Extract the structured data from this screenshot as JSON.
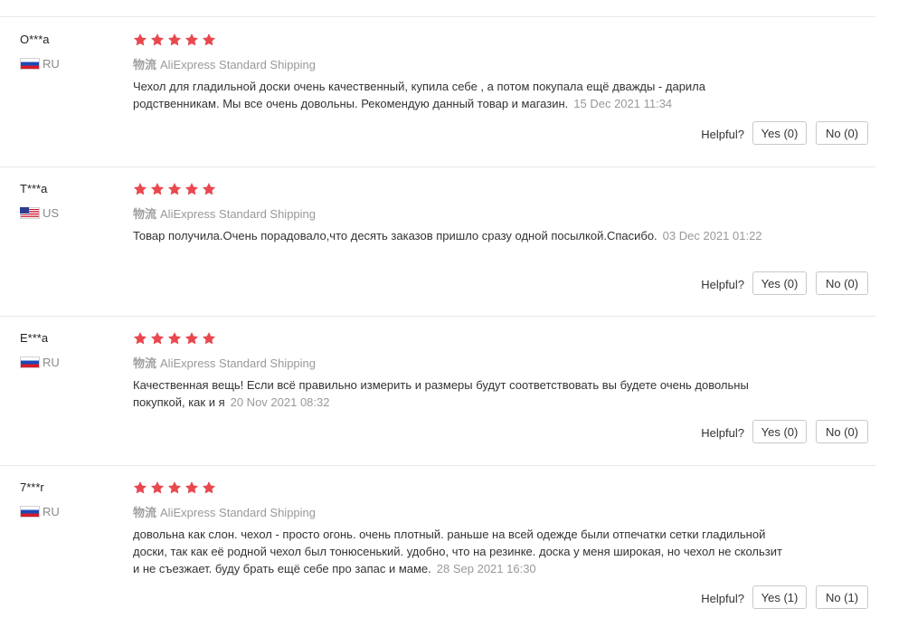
{
  "reviews": [
    {
      "user": "O***a",
      "country": "RU",
      "logistics_label": "物流",
      "shipping": "AliExpress Standard Shipping",
      "text": "Чехол для гладильной доски очень качественный, купила себе , а потом покупала ещё дважды - дарила родственникам. Мы все очень довольны. Рекомендую данный товар и магазин.",
      "date": "15 Dec 2021 11:34",
      "helpful_label": "Helpful?",
      "yes_label": "Yes (0)",
      "no_label": "No (0)"
    },
    {
      "user": "T***a",
      "country": "US",
      "logistics_label": "物流",
      "shipping": "AliExpress Standard Shipping",
      "text": "Товар получила.Очень порадовало,что десять заказов пришло сразу одной посылкой.Спасибо.",
      "date": "03 Dec 2021 01:22",
      "helpful_label": "Helpful?",
      "yes_label": "Yes (0)",
      "no_label": "No (0)"
    },
    {
      "user": "E***a",
      "country": "RU",
      "logistics_label": "物流",
      "shipping": "AliExpress Standard Shipping",
      "text": "Качественная вещь! Если всё правильно измерить и размеры будут соответствовать вы будете очень довольны покупкой, как и я",
      "date": "20 Nov 2021 08:32",
      "helpful_label": "Helpful?",
      "yes_label": "Yes (0)",
      "no_label": "No (0)"
    },
    {
      "user": "7***r",
      "country": "RU",
      "logistics_label": "物流",
      "shipping": "AliExpress Standard Shipping",
      "text": "довольна как слон. чехол - просто огонь. очень плотный. раньше на всей одежде были отпечатки сетки гладильной доски, так как её родной чехол был тонюсенький. удобно, что на резинке. доска у меня широкая, но чехол не скользит и не съезжает. буду брать ещё себе про запас и маме.",
      "date": "28 Sep 2021 16:30",
      "helpful_label": "Helpful?",
      "yes_label": "Yes (1)",
      "no_label": "No (1)"
    }
  ],
  "rating": {
    "stars": 5,
    "max": 5
  },
  "colors": {
    "star": "#e8484e",
    "divider": "#e8e8e8",
    "muted": "#999999"
  },
  "icons": {
    "star": "star-icon",
    "flag_ru": "russia-flag-icon",
    "flag_us": "usa-flag-icon"
  }
}
